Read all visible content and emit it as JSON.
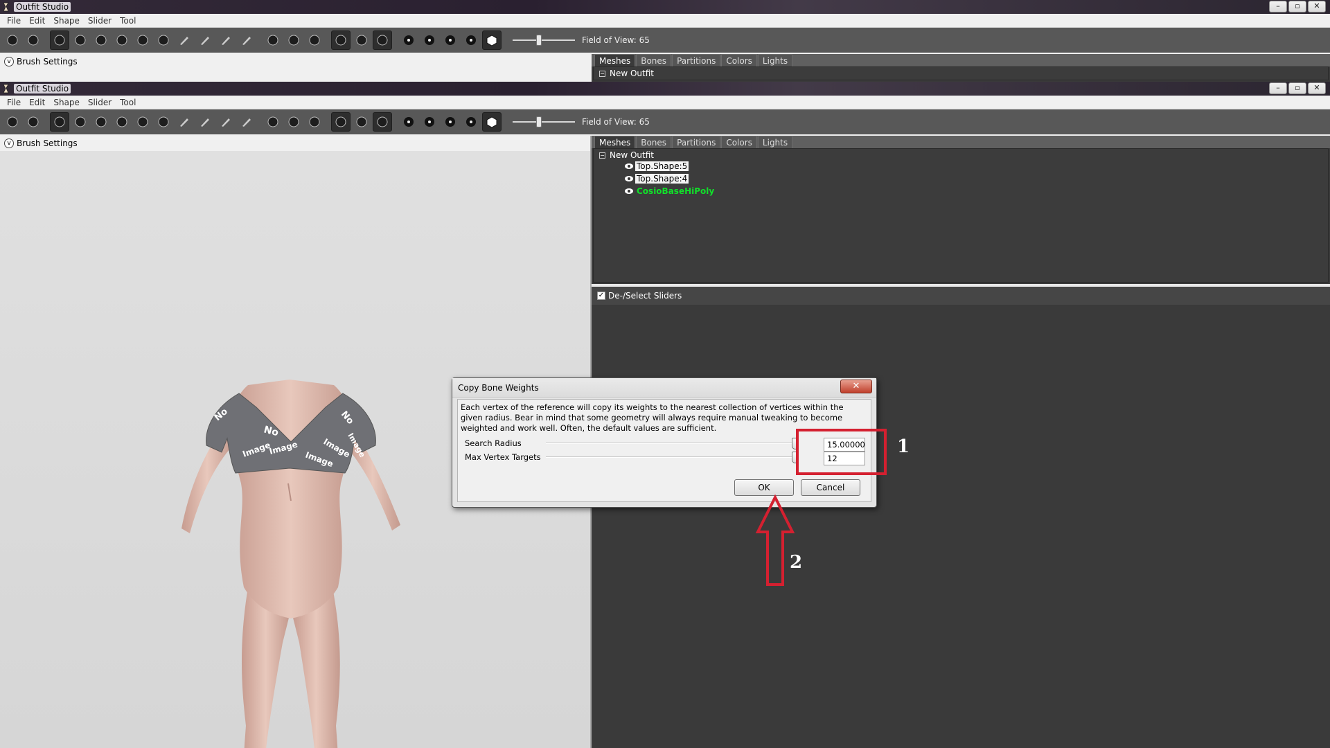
{
  "app": {
    "title": "Outfit Studio",
    "window_buttons": [
      "–",
      "▫",
      "✕"
    ]
  },
  "menu": [
    "File",
    "Edit",
    "Shape",
    "Slider",
    "Tool"
  ],
  "toolbar": {
    "fov_label": "Field of View: 65",
    "fov_value": 65
  },
  "brush_settings": {
    "label": "Brush Settings"
  },
  "panel": {
    "tabs": [
      "Meshes",
      "Bones",
      "Partitions",
      "Colors",
      "Lights"
    ],
    "active_tab": "Meshes",
    "tree": {
      "root": "New Outfit",
      "expander": "−",
      "shapes": [
        "Top.Shape:5",
        "Top.Shape:4"
      ],
      "reference": "CosioBaseHiPoly"
    },
    "sliders_header": "De-/Select Sliders",
    "sliders_checked": true
  },
  "viewport": {
    "texture_text": [
      "No",
      "Image",
      "No",
      "Image",
      "Image",
      "No",
      "Image",
      "Image"
    ]
  },
  "dialog": {
    "title": "Copy Bone Weights",
    "close": "✕",
    "description": "Each vertex of the reference will copy its weights to the nearest collection of vertices within the given radius. Bear in mind that some geometry will always require manual tweaking to become weighted and work well. Often, the default values are sufficient.",
    "fields": [
      {
        "label": "Search Radius",
        "value": "15.00000",
        "slider_fraction": 1.0
      },
      {
        "label": "Max Vertex Targets",
        "value": "12",
        "slider_fraction": 1.0
      }
    ],
    "ok": "OK",
    "cancel": "Cancel"
  },
  "annotations": {
    "label_1": "1",
    "label_2": "2",
    "color": "#d42030"
  },
  "colors": {
    "toolbar_bg": "#585858",
    "panel_bg": "#3a3a3a",
    "reference_shape": "#11e02a"
  }
}
